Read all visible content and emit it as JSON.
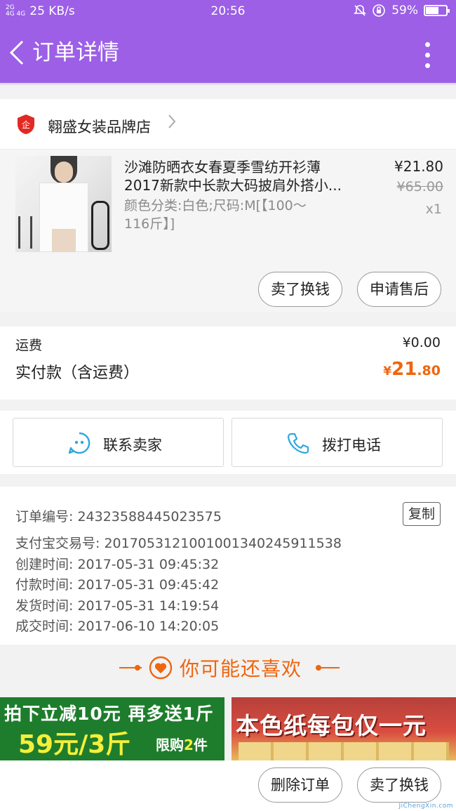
{
  "statusbar": {
    "signal_top": "2G",
    "signal_bottom": "4G 4G",
    "speed": "25 KB/s",
    "time": "20:56",
    "battery": "59%"
  },
  "navbar": {
    "title": "订单详情"
  },
  "shop": {
    "name": "翱盛女装品牌店"
  },
  "item": {
    "title_line1": "沙滩防晒衣女春夏季雪纺开衫薄",
    "title_line2": "2017新款中长款大码披肩外搭小...",
    "sku_line1": "颜色分类:白色;尺码:M[【100〜",
    "sku_line2": "116斤】]",
    "price": "¥21.80",
    "original_price": "¥65.00",
    "quantity": "x1",
    "sell_button": "卖了换钱",
    "aftersale_button": "申请售后"
  },
  "fees": {
    "shipping_label": "运费",
    "shipping_value": "¥0.00",
    "paid_label": "实付款（含运费）",
    "paid_currency": "¥",
    "paid_int": "21",
    "paid_dec": ".80"
  },
  "contact": {
    "seller_label": "联系卖家",
    "phone_label": "拨打电话"
  },
  "order_info": {
    "order_no": "订单编号: 24323588445023575",
    "copy_label": "复制",
    "alipay_no": "支付宝交易号: 2017053121001001340245911538",
    "created": "创建时间: 2017-05-31 09:45:32",
    "paid": "付款时间: 2017-05-31 09:45:42",
    "shipped": "发货时间: 2017-05-31 14:19:54",
    "completed": "成交时间: 2017-06-10 14:20:05"
  },
  "recommend": {
    "title": "你可能还喜欢"
  },
  "ads": {
    "ad1_line1": "拍下立减10元 再多送1斤",
    "ad1_line2": "59元/3斤",
    "ad1_line3_prefix": "限购",
    "ad1_line3_num": "2",
    "ad1_line3_suffix": "件",
    "ad2_text": "本色纸每包仅一元"
  },
  "bottom": {
    "delete_button": "删除订单",
    "sell_button": "卖了换钱"
  },
  "watermark": "JiChengXin.com",
  "colors": {
    "accent": "#9c5fe6",
    "price_orange": "#f0650e",
    "contact_icon": "#2ea7e0"
  }
}
